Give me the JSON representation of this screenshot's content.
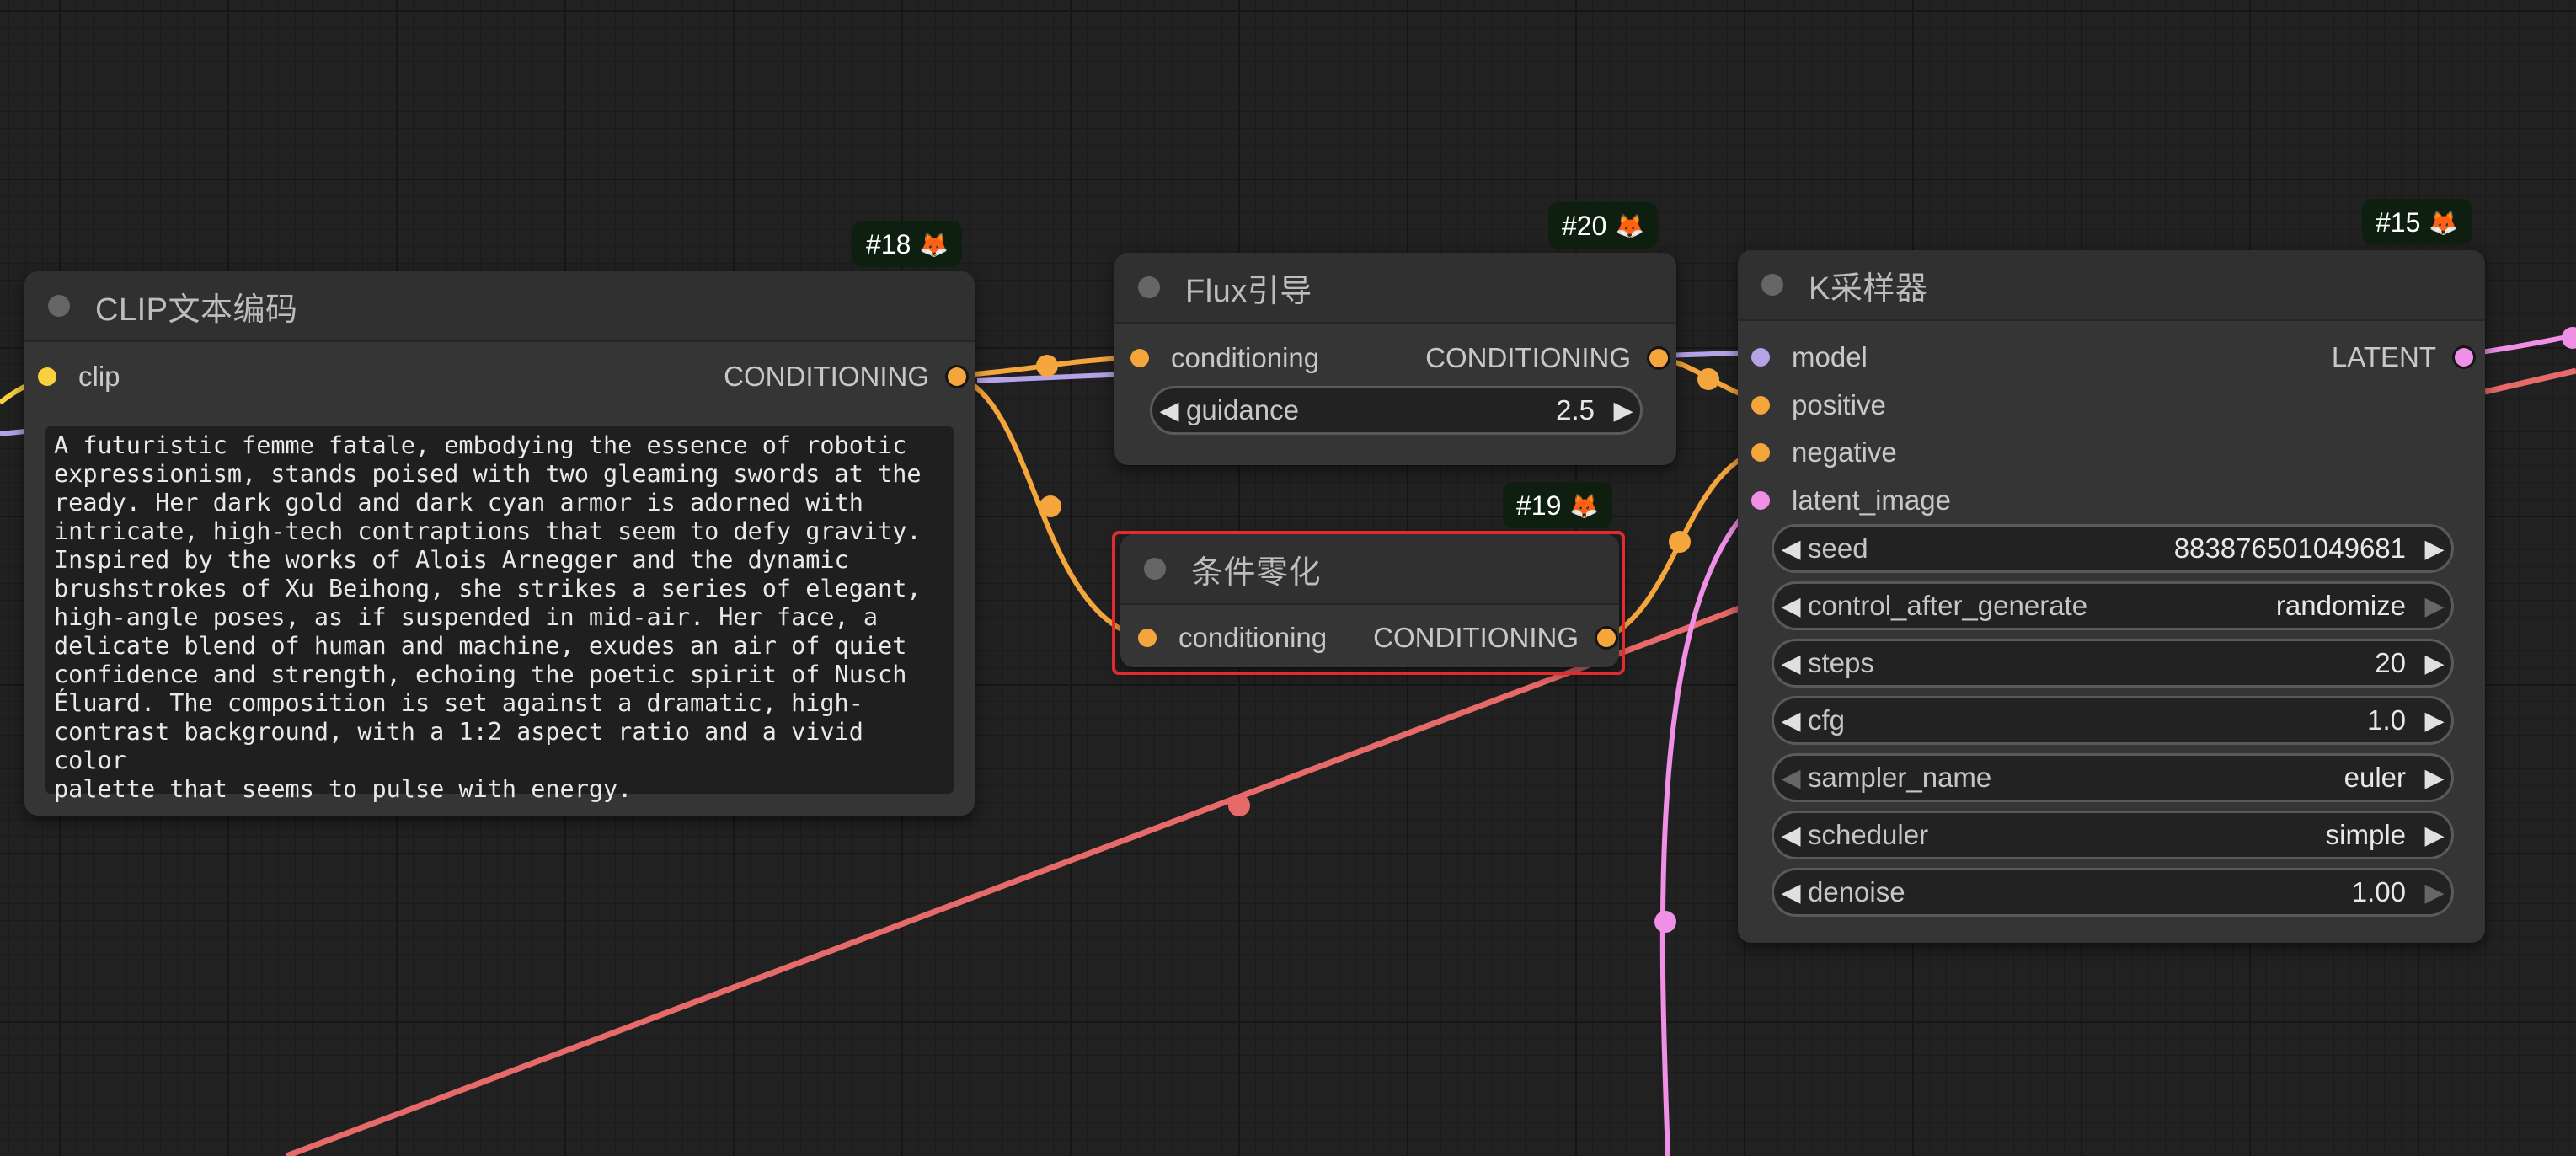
{
  "nodes": {
    "clip": {
      "badge": "#18",
      "title": "CLIP文本编码",
      "input": "clip",
      "output": "CONDITIONING",
      "text": "A futuristic femme fatale, embodying the essence of robotic\nexpressionism, stands poised with two gleaming swords at the\nready. Her dark gold and dark cyan armor is adorned with\nintricate, high-tech contraptions that seem to defy gravity.\nInspired by the works of Alois Arnegger and the dynamic\nbrushstrokes of Xu Beihong, she strikes a series of elegant,\nhigh-angle poses, as if suspended in mid-air. Her face, a\ndelicate blend of human and machine, exudes an air of quiet\nconfidence and strength, echoing the poetic spirit of Nusch\nÉluard. The composition is set against a dramatic, high-\ncontrast background, with a 1:2 aspect ratio and a vivid color\npalette that seems to pulse with energy."
    },
    "flux": {
      "badge": "#20",
      "title": "Flux引导",
      "input": "conditioning",
      "output": "CONDITIONING",
      "widget_label": "guidance",
      "widget_value": "2.5"
    },
    "zero": {
      "badge": "#19",
      "title": "条件零化",
      "input": "conditioning",
      "output": "CONDITIONING"
    },
    "ksampler": {
      "badge": "#15",
      "title": "K采样器",
      "inputs": [
        "model",
        "positive",
        "negative",
        "latent_image"
      ],
      "output": "LATENT",
      "widgets": [
        {
          "label": "seed",
          "value": "883876501049681"
        },
        {
          "label": "control_after_generate",
          "value": "randomize"
        },
        {
          "label": "steps",
          "value": "20"
        },
        {
          "label": "cfg",
          "value": "1.0"
        },
        {
          "label": "sampler_name",
          "value": "euler"
        },
        {
          "label": "scheduler",
          "value": "simple"
        },
        {
          "label": "denoise",
          "value": "1.00"
        }
      ]
    }
  },
  "badge_icon": "fox-icon",
  "colors": {
    "canvas": "#212121",
    "node_body": "#353535",
    "clip_link": "#f7d23e",
    "conditioning_link": "#f4a53c",
    "model_link": "#b5a3e8",
    "latent_link": "#f08fe6",
    "vae_link": "#e76a6a",
    "selection": "#e02c2c"
  }
}
